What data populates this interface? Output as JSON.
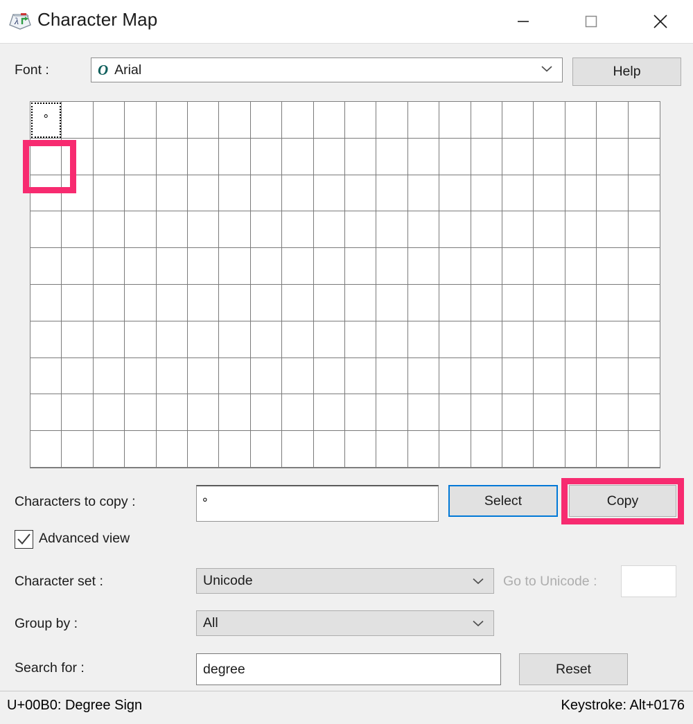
{
  "window": {
    "title": "Character Map",
    "app_icon": "character-map-icon",
    "controls": {
      "minimize": "minimize-icon",
      "maximize": "maximize-icon",
      "close": "close-icon"
    }
  },
  "font_row": {
    "label": "Font :",
    "selected_font": "Arial",
    "font_type_icon": "O",
    "dropdown_icon": "chevron-down-icon",
    "help_label": "Help"
  },
  "grid": {
    "columns": 20,
    "rows": 10,
    "selected_index": 0,
    "cells": [
      "°"
    ]
  },
  "copy_row": {
    "label": "Characters to copy :",
    "value": "°",
    "select_label": "Select",
    "copy_label": "Copy"
  },
  "advanced_view": {
    "label": "Advanced view",
    "checked": true,
    "check_icon": "check-icon"
  },
  "character_set": {
    "label": "Character set :",
    "value": "Unicode",
    "dropdown_icon": "chevron-down-icon"
  },
  "group_by": {
    "label": "Group by :",
    "value": "All",
    "dropdown_icon": "chevron-down-icon"
  },
  "go_to_unicode": {
    "label": "Go to Unicode :",
    "value": "",
    "disabled": true
  },
  "search": {
    "label": "Search for :",
    "value": "degree",
    "reset_label": "Reset"
  },
  "status_bar": {
    "left": "U+00B0: Degree Sign",
    "right": "Keystroke: Alt+0176"
  },
  "annotations": {
    "highlight_color": "#f72b70",
    "focus_color": "#0078d7",
    "targets": [
      "selected-character-cell",
      "copy-button"
    ]
  }
}
